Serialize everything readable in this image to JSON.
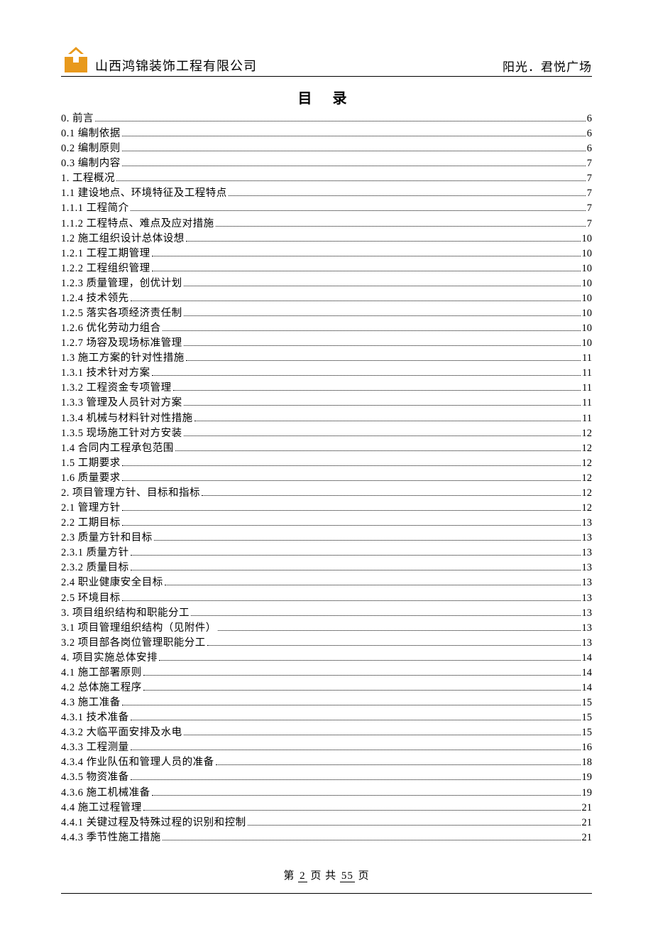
{
  "header": {
    "company": "山西鸿锦装饰工程有限公司",
    "project": "阳光．君悦广场"
  },
  "title": "目  录",
  "toc": [
    {
      "label": "0. 前言",
      "page": "6"
    },
    {
      "label": "0.1 编制依据",
      "page": "6"
    },
    {
      "label": "0.2 编制原则",
      "page": "6"
    },
    {
      "label": "0.3 编制内容",
      "page": "7"
    },
    {
      "label": "1. 工程概况",
      "page": "7"
    },
    {
      "label": "1.1 建设地点、环境特征及工程特点",
      "page": "7"
    },
    {
      "label": "1.1.1 工程简介",
      "page": "7"
    },
    {
      "label": "1.1.2 工程特点、难点及应对措施",
      "page": "7"
    },
    {
      "label": "1.2 施工组织设计总体设想",
      "page": "10"
    },
    {
      "label": "1.2.1 工程工期管理",
      "page": "10"
    },
    {
      "label": "1.2.2 工程组织管理",
      "page": "10"
    },
    {
      "label": "1.2.3 质量管理，创优计划",
      "page": "10"
    },
    {
      "label": "1.2.4 技术领先",
      "page": "10"
    },
    {
      "label": "1.2.5 落实各项经济责任制",
      "page": "10"
    },
    {
      "label": "1.2.6 优化劳动力组合",
      "page": "10"
    },
    {
      "label": "1.2.7 场容及现场标准管理",
      "page": "10"
    },
    {
      "label": "1.3 施工方案的针对性措施",
      "page": "11"
    },
    {
      "label": "1.3.1 技术针对方案",
      "page": "11"
    },
    {
      "label": "1.3.2 工程资金专项管理",
      "page": "11"
    },
    {
      "label": "1.3.3 管理及人员针对方案",
      "page": "11"
    },
    {
      "label": "1.3.4 机械与材料针对性措施",
      "page": "11"
    },
    {
      "label": "1.3.5 现场施工针对方安装",
      "page": "12"
    },
    {
      "label": "1.4 合同内工程承包范围",
      "page": "12"
    },
    {
      "label": "1.5 工期要求",
      "page": "12"
    },
    {
      "label": "1.6 质量要求",
      "page": "12"
    },
    {
      "label": "2. 项目管理方针、目标和指标",
      "page": "12"
    },
    {
      "label": "2.1 管理方针",
      "page": "12"
    },
    {
      "label": "2.2 工期目标",
      "page": "13"
    },
    {
      "label": "2.3 质量方针和目标",
      "page": "13"
    },
    {
      "label": "2.3.1 质量方针",
      "page": "13"
    },
    {
      "label": "2.3.2 质量目标",
      "page": "13"
    },
    {
      "label": "2.4 职业健康安全目标",
      "page": "13"
    },
    {
      "label": "2.5 环境目标",
      "page": "13"
    },
    {
      "label": "3. 项目组织结构和职能分工",
      "page": "13"
    },
    {
      "label": "3.1 项目管理组织结构（见附件）",
      "page": "13"
    },
    {
      "label": "3.2 项目部各岗位管理职能分工",
      "page": "13"
    },
    {
      "label": "4. 项目实施总体安排",
      "page": "14"
    },
    {
      "label": "4.1 施工部署原则",
      "page": "14"
    },
    {
      "label": "4.2 总体施工程序",
      "page": "14"
    },
    {
      "label": "4.3 施工准备",
      "page": "15"
    },
    {
      "label": "4.3.1 技术准备",
      "page": "15"
    },
    {
      "label": "4.3.2 大临平面安排及水电",
      "page": "15"
    },
    {
      "label": "4.3.3 工程测量",
      "page": "16"
    },
    {
      "label": "4.3.4 作业队伍和管理人员的准备",
      "page": "18"
    },
    {
      "label": "4.3.5 物资准备",
      "page": "19"
    },
    {
      "label": "4.3.6 施工机械准备",
      "page": "19"
    },
    {
      "label": "4.4 施工过程管理",
      "page": "21"
    },
    {
      "label": "4.4.1 关键过程及特殊过程的识别和控制",
      "page": "21"
    },
    {
      "label": "4.4.3 季节性施工措施",
      "page": "21"
    }
  ],
  "footer": {
    "prefix": "第",
    "current": "2",
    "mid": "页 共",
    "total": "55",
    "suffix": "页"
  }
}
